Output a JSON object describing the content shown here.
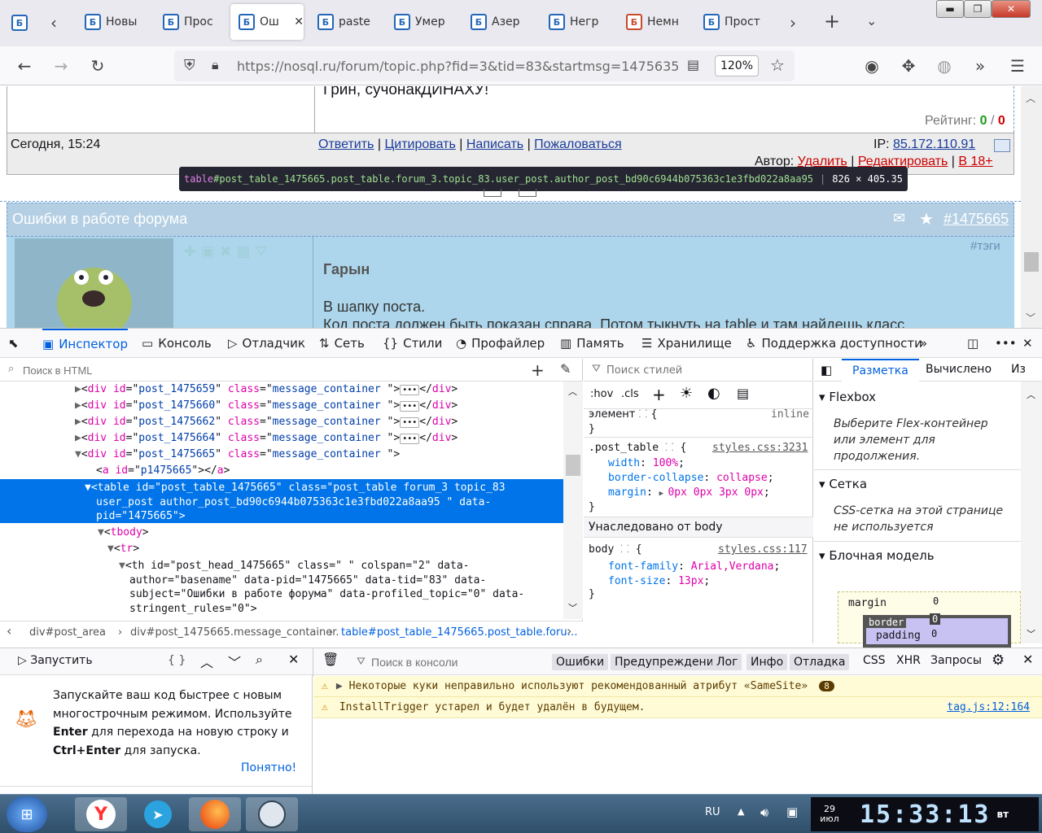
{
  "browser": {
    "tabs": [
      {
        "label": "Новы",
        "favicon": "nosql-favicon"
      },
      {
        "label": "Прос",
        "favicon": "nosql-favicon"
      },
      {
        "label": "Ош",
        "favicon": "nosql-favicon",
        "active": true
      },
      {
        "label": "pastе",
        "favicon": "nosql-favicon"
      },
      {
        "label": "Умер",
        "favicon": "nosql-favicon"
      },
      {
        "label": "Азер",
        "favicon": "nosql-favicon"
      },
      {
        "label": "Негр",
        "favicon": "nosql-favicon"
      },
      {
        "label": "Немн",
        "favicon": "red-favicon"
      },
      {
        "label": "Прост",
        "favicon": "nosql-favicon"
      }
    ],
    "url": "https://nosql.ru/forum/topic.php?fid=3&tid=83&startmsg=1475635",
    "zoom": "120%"
  },
  "page": {
    "prev_post_text": "Грин, сучонакДИНАХУ!",
    "rating_label": "Рейтинг:",
    "rating_pos": "0",
    "rating_sep": "/",
    "rating_neg": "0",
    "prev_date": "Сегодня, 15:24",
    "actions": [
      "Ответить",
      "Цитировать",
      "Написать",
      "Пожаловаться"
    ],
    "ip_label": "IP:",
    "ip_value": "85.172.110.91",
    "author_label": "Автор:",
    "author_actions": [
      "Удалить",
      "Редактировать",
      "В 18+"
    ],
    "topic_title": "Ошибки в работе форума",
    "post_anchor": "#1475665",
    "tags_label": "#тэги",
    "author_name": "Гарын",
    "body_line1": "В шапку поста.",
    "body_line2": "Код поста должен быть показан справа. Потом тыкнуть на table и там найдешь класс"
  },
  "tooltip": {
    "tag": "table",
    "selector": "#post_table_1475665.post_table.forum_3.topic_83.user_post.author_post_bd90c6944b075363c1e3fbd022a8aa95",
    "size": "826 × 405.35"
  },
  "devtools": {
    "tabs": [
      "Инспектор",
      "Консоль",
      "Отладчик",
      "Сеть",
      "Стили",
      "Профайлер",
      "Память",
      "Хранилище",
      "Поддержка доступности"
    ],
    "html_search_placeholder": "Поиск в HTML",
    "tree": [
      {
        "indent": 0,
        "arrow": "▶",
        "tag": "div",
        "id": "post_1475659",
        "class": "message_container ",
        "collapsed": true
      },
      {
        "indent": 0,
        "arrow": "▶",
        "tag": "div",
        "id": "post_1475660",
        "class": "message_container ",
        "collapsed": true
      },
      {
        "indent": 0,
        "arrow": "▶",
        "tag": "div",
        "id": "post_1475662",
        "class": "message_container ",
        "collapsed": true
      },
      {
        "indent": 0,
        "arrow": "▶",
        "tag": "div",
        "id": "post_1475664",
        "class": "message_container ",
        "collapsed": true
      },
      {
        "indent": 0,
        "arrow": "▼",
        "tag": "div",
        "id": "post_1475665",
        "class": "message_container ",
        "collapsed": false
      }
    ],
    "anchor_line": "<a id=\"p1475665\"></a>",
    "selected_lines": [
      "<table id=\"post_table_1475665\" class=\"post_table forum_3 topic_83",
      "user_post author_post_bd90c6944b075363c1e3fbd022a8aa95 \" data-",
      "pid=\"1475665\">"
    ],
    "tbody_line": "<tbody>",
    "tr_line": "<tr>",
    "th_lines": [
      "<th id=\"post_head_1475665\" class=\" \" colspan=\"2\" data-",
      "author=\"basename\" data-pid=\"1475665\" data-tid=\"83\" data-",
      "subject=\"Ошибки в работе форума\" data-profiled_topic=\"0\" data-",
      "stringent_rules=\"0\">"
    ],
    "breadcrumbs": [
      "div#post_area",
      "div#post_1475665.message_container.",
      "table#post_table_1475665.post_table.foru…"
    ],
    "styles_search_placeholder": "Поиск стилей",
    "hov": ":hov",
    "cls": ".cls",
    "element_rule": "элемент",
    "inline": "inline",
    "post_table_selector": ".post_table",
    "post_table_src": "styles.css:3231",
    "post_table_props": [
      {
        "name": "width",
        "value": "100%"
      },
      {
        "name": "border-collapse",
        "value": "collapse"
      },
      {
        "name": "margin",
        "value": "0px 0px 3px 0px"
      }
    ],
    "inherited_label": "Унаследовано от body",
    "body_selector": "body",
    "body_src": "styles.css:117",
    "body_props": [
      {
        "name": "font-family",
        "value": "Arial,Verdana"
      },
      {
        "name": "font-size",
        "value": "13px"
      }
    ],
    "layout_tabs": [
      "Разметка",
      "Вычислено",
      "Из"
    ],
    "flexbox_title": "Flexbox",
    "flexbox_note": "Выберите Flex-контейнер или элемент для продолжения.",
    "grid_title": "Сетка",
    "grid_note": "CSS-сетка на этой странице не используется",
    "boxmodel_title": "Блочная модель",
    "box_margin": "margin",
    "box_border": "border",
    "box_padding": "padding",
    "box_zero": "0"
  },
  "console": {
    "run_label": "Запустить",
    "braces": "{ }",
    "search_placeholder": "Поиск в консоли",
    "filters": [
      "Ошибки",
      "Предупреждения",
      "Лог",
      "Инфо",
      "Отладка"
    ],
    "filters_plain": [
      "CSS",
      "XHR",
      "Запросы"
    ],
    "tip_line1": "Запускайте ваш код быстрее с новым",
    "tip_line2": "многострочным режимом. Используйте",
    "tip_enter": "Enter",
    "tip_line3": " для перехода на новую строку и",
    "tip_ctrl": "Ctrl+Enter",
    "tip_line4": " для запуска.",
    "got_it": "Понятно!",
    "warn1": "Некоторые куки неправильно используют рекомендованный атрибут «SameSite»",
    "warn1_count": "8",
    "warn2": "InstallTrigger устарел и будет удалён в будущем.",
    "warn2_src": "tag.js:12:164"
  },
  "taskbar": {
    "lang": "RU",
    "date_day": "29",
    "date_month": "июл",
    "time": "15:33:13",
    "weekday": "вт"
  }
}
